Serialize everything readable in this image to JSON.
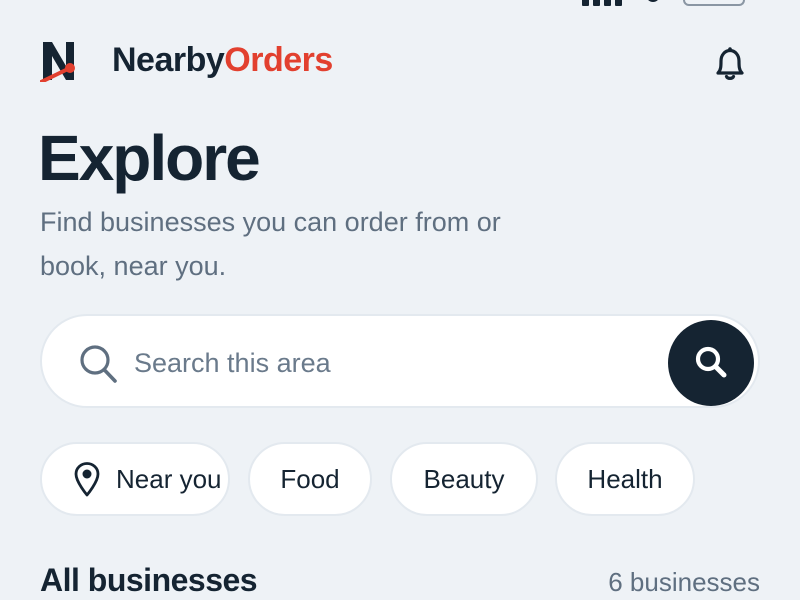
{
  "app": {
    "brand_part1": "Nearby",
    "brand_part2": "Orders",
    "logo_letter": "N"
  },
  "hero": {
    "title": "Explore",
    "subtitle": "Find businesses you can order from or book, near you."
  },
  "search": {
    "placeholder": "Search this area",
    "value": ""
  },
  "filters": [
    {
      "label": "Near you",
      "icon": "location-pin-icon"
    },
    {
      "label": "Food"
    },
    {
      "label": "Beauty"
    },
    {
      "label": "Health"
    }
  ],
  "list": {
    "title": "All businesses",
    "count_label": "6 businesses"
  },
  "icons": {
    "notifications": "bell-icon",
    "search": "search-icon"
  },
  "colors": {
    "background": "#eef2f6",
    "text": "#152432",
    "accent": "#e2402f",
    "muted": "#5f6f80",
    "surface": "#ffffff"
  }
}
